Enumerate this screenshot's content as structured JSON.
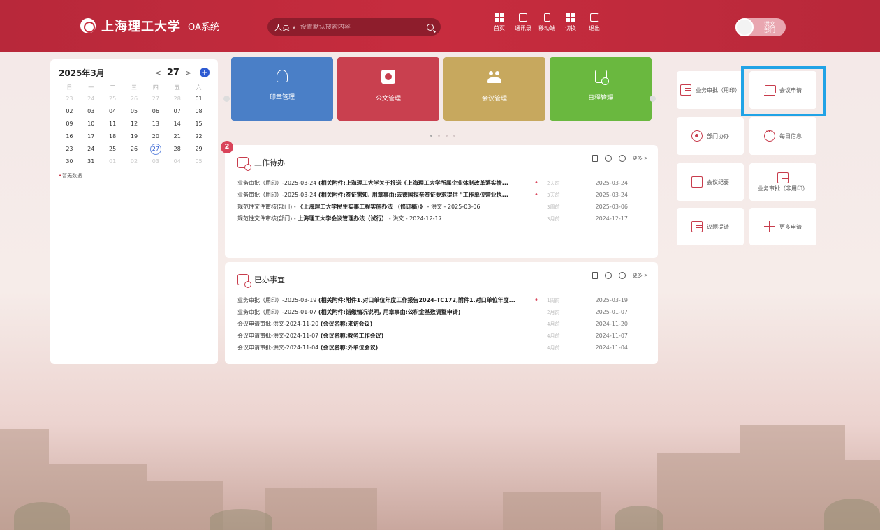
{
  "header": {
    "logo_text": "上海理工大学",
    "system_name": "OA系统",
    "search": {
      "scope": "人员",
      "placeholder": "设置默认搜索内容"
    },
    "nav": [
      {
        "label": "首页",
        "icon": "home-grid-icon"
      },
      {
        "label": "通讯录",
        "icon": "contacts-icon"
      },
      {
        "label": "移动端",
        "icon": "mobile-icon"
      },
      {
        "label": "切换",
        "icon": "apps-icon"
      },
      {
        "label": "退出",
        "icon": "logout-icon"
      }
    ],
    "user": {
      "name": "洪文",
      "dept": "部门"
    }
  },
  "calendar": {
    "title": "2025年3月",
    "current_day": "27",
    "prev": "<",
    "next": ">",
    "add": "+",
    "weekdays": [
      "日",
      "一",
      "二",
      "三",
      "四",
      "五",
      "六"
    ],
    "weeks": [
      [
        {
          "d": "23",
          "m": 1
        },
        {
          "d": "24",
          "m": 1
        },
        {
          "d": "25",
          "m": 1
        },
        {
          "d": "26",
          "m": 1
        },
        {
          "d": "27",
          "m": 1
        },
        {
          "d": "28",
          "m": 1
        },
        {
          "d": "01",
          "m": 0
        }
      ],
      [
        {
          "d": "02",
          "m": 0
        },
        {
          "d": "03",
          "m": 0
        },
        {
          "d": "04",
          "m": 0
        },
        {
          "d": "05",
          "m": 0
        },
        {
          "d": "06",
          "m": 0
        },
        {
          "d": "07",
          "m": 0
        },
        {
          "d": "08",
          "m": 0
        }
      ],
      [
        {
          "d": "09",
          "m": 0
        },
        {
          "d": "10",
          "m": 0
        },
        {
          "d": "11",
          "m": 0
        },
        {
          "d": "12",
          "m": 0
        },
        {
          "d": "13",
          "m": 0
        },
        {
          "d": "14",
          "m": 0
        },
        {
          "d": "15",
          "m": 0
        }
      ],
      [
        {
          "d": "16",
          "m": 0
        },
        {
          "d": "17",
          "m": 0
        },
        {
          "d": "18",
          "m": 0
        },
        {
          "d": "19",
          "m": 0
        },
        {
          "d": "20",
          "m": 0
        },
        {
          "d": "21",
          "m": 0
        },
        {
          "d": "22",
          "m": 0
        }
      ],
      [
        {
          "d": "23",
          "m": 0
        },
        {
          "d": "24",
          "m": 0
        },
        {
          "d": "25",
          "m": 0
        },
        {
          "d": "26",
          "m": 0
        },
        {
          "d": "27",
          "m": 0,
          "today": 1
        },
        {
          "d": "28",
          "m": 0
        },
        {
          "d": "29",
          "m": 0
        }
      ],
      [
        {
          "d": "30",
          "m": 0
        },
        {
          "d": "31",
          "m": 0
        },
        {
          "d": "01",
          "m": 1
        },
        {
          "d": "02",
          "m": 1
        },
        {
          "d": "03",
          "m": 1
        },
        {
          "d": "04",
          "m": 1
        },
        {
          "d": "05",
          "m": 1
        }
      ]
    ],
    "note": "暂无数据"
  },
  "modules": [
    {
      "label": "印章管理",
      "color": "#4a7fc7",
      "icon": "stamp-icon"
    },
    {
      "label": "公文管理",
      "color": "#c9404f",
      "icon": "document-icon"
    },
    {
      "label": "会议管理",
      "color": "#c7a85e",
      "icon": "meeting-icon"
    },
    {
      "label": "日程管理",
      "color": "#6ab83f",
      "icon": "schedule-icon"
    }
  ],
  "todo": {
    "title": "工作待办",
    "badge": "2",
    "more": "更多 >",
    "rows": [
      {
        "prefix": "业务审批（用印）-2025-03-24 ",
        "bold": "(相关附件:上海理工大学关于报送《上海理工大学所属企业体制改革落实情...",
        "suffix": "",
        "dot": "•",
        "ago": "2天前",
        "date": "2025-03-24"
      },
      {
        "prefix": "业务审批（用印）-2025-03-24 ",
        "bold": "(相关附件:签证需知, 用章事由:去德国探亲签证要求提供 \"工作单位营业执...",
        "suffix": "",
        "dot": "•",
        "ago": "3天前",
        "date": "2025-03-24"
      },
      {
        "prefix": "规范性文件审核(部门) - ",
        "bold": "《上海理工大学民生实事工程实施办法 （修订稿）》",
        "suffix": " - 洪文 - 2025-03-06",
        "dot": "",
        "ago": "3周前",
        "date": "2025-03-06"
      },
      {
        "prefix": "规范性文件审核(部门) - ",
        "bold": "上海理工大学会议管理办法（试行）",
        "suffix": " - 洪文 - 2024-12-17",
        "dot": "",
        "ago": "3月前",
        "date": "2024-12-17"
      }
    ]
  },
  "done": {
    "title": "已办事宜",
    "more": "更多 >",
    "rows": [
      {
        "prefix": "业务审批（用印）-2025-03-19 ",
        "bold": "(相关附件:附件1.对口单位年度工作报告2024-TC172,附件1.对口单位年度...",
        "suffix": "",
        "dot": "•",
        "ago": "1周前",
        "date": "2025-03-19"
      },
      {
        "prefix": "业务审批（用印）-2025-01-07 ",
        "bold": "(相关附件:错缴情况说明, 用章事由:公积金基数调整申请)",
        "suffix": "",
        "dot": "",
        "ago": "2月前",
        "date": "2025-01-07"
      },
      {
        "prefix": "会议申请审批-洪文-2024-11-20 ",
        "bold": "(会议名称:来访会议)",
        "suffix": "",
        "dot": "",
        "ago": "4月前",
        "date": "2024-11-20"
      },
      {
        "prefix": "会议申请审批-洪文-2024-11-07 ",
        "bold": "(会议名称:教务工作会议)",
        "suffix": "",
        "dot": "",
        "ago": "4月前",
        "date": "2024-11-07"
      },
      {
        "prefix": "会议申请审批-洪文-2024-11-04 ",
        "bold": "(会议名称:外单位会议)",
        "suffix": "",
        "dot": "",
        "ago": "4月前",
        "date": "2024-11-04"
      }
    ]
  },
  "quick": [
    {
      "label": "业务审批（用印）",
      "icon": "approval-doc-icon"
    },
    {
      "label": "会议申请",
      "icon": "meeting-apply-icon"
    },
    {
      "label": "部门协办",
      "icon": "collaborate-icon"
    },
    {
      "label": "每日信息",
      "icon": "daily-info-icon"
    },
    {
      "label": "会议纪要",
      "icon": "minutes-icon"
    },
    {
      "label": "业务审批（非用印）",
      "icon": "approval-nonseal-icon"
    },
    {
      "label": "议题提请",
      "icon": "topic-icon"
    },
    {
      "label": "更多申请",
      "icon": "plus-icon"
    }
  ],
  "colors": {
    "brand": "#c72c3e",
    "highlight": "#21a3e6"
  }
}
